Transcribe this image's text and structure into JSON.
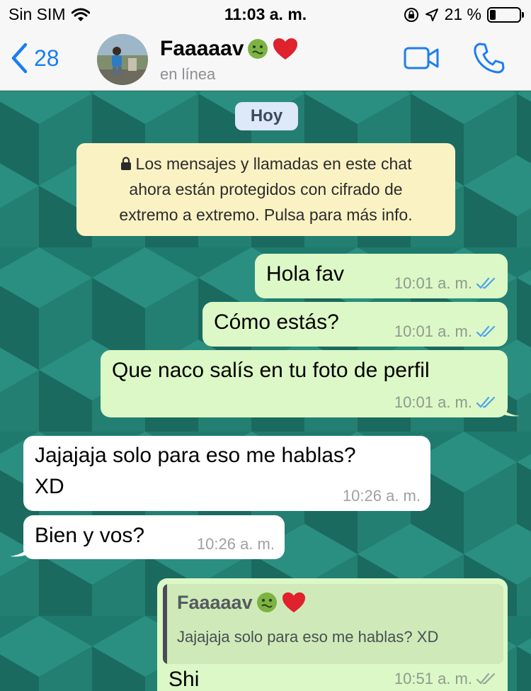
{
  "status_bar": {
    "carrier": "Sin SIM",
    "time": "11:03 a. m.",
    "battery_percent": "21 %",
    "battery_level": 0.21
  },
  "header": {
    "back_count": "28",
    "contact_name": "Faaaaav",
    "contact_status": "en línea",
    "icons": [
      "back-chevron-icon",
      "video-call-icon",
      "phone-icon",
      "nauseated-face-emoji",
      "red-heart-emoji"
    ]
  },
  "chat": {
    "date_label": "Hoy",
    "encryption_notice": {
      "line1": "Los mensajes y llamadas en este chat",
      "line2": "ahora están protegidos con cifrado de",
      "line3": "extremo a extremo. Pulsa para más info."
    },
    "messages": [
      {
        "direction": "out",
        "text": "Hola fav",
        "time": "10:01 a. m."
      },
      {
        "direction": "out",
        "text": "Cómo estás?",
        "time": "10:01 a. m."
      },
      {
        "direction": "out",
        "text": "Que naco salís en tu foto de perfil",
        "time": "10:01 a. m."
      },
      {
        "direction": "in",
        "text_line1": "Jajajaja solo para eso me hablas?",
        "text_line2": "XD",
        "time": "10:26 a. m."
      },
      {
        "direction": "in",
        "text": "Bien y vos?",
        "time": "10:26 a. m."
      },
      {
        "direction": "out",
        "reply_to_name": "Faaaaav",
        "reply_to_text": "Jajajaja solo para eso me hablas? XD",
        "text": "Shi",
        "time": "10:51 a. m."
      }
    ]
  },
  "colors": {
    "accent": "#1a7ef2",
    "outgoing_bubble": "#dcf8c6",
    "incoming_bubble": "#ffffff",
    "read_ticks": "#4fa3e8",
    "wallpaper": "#1b7266"
  }
}
